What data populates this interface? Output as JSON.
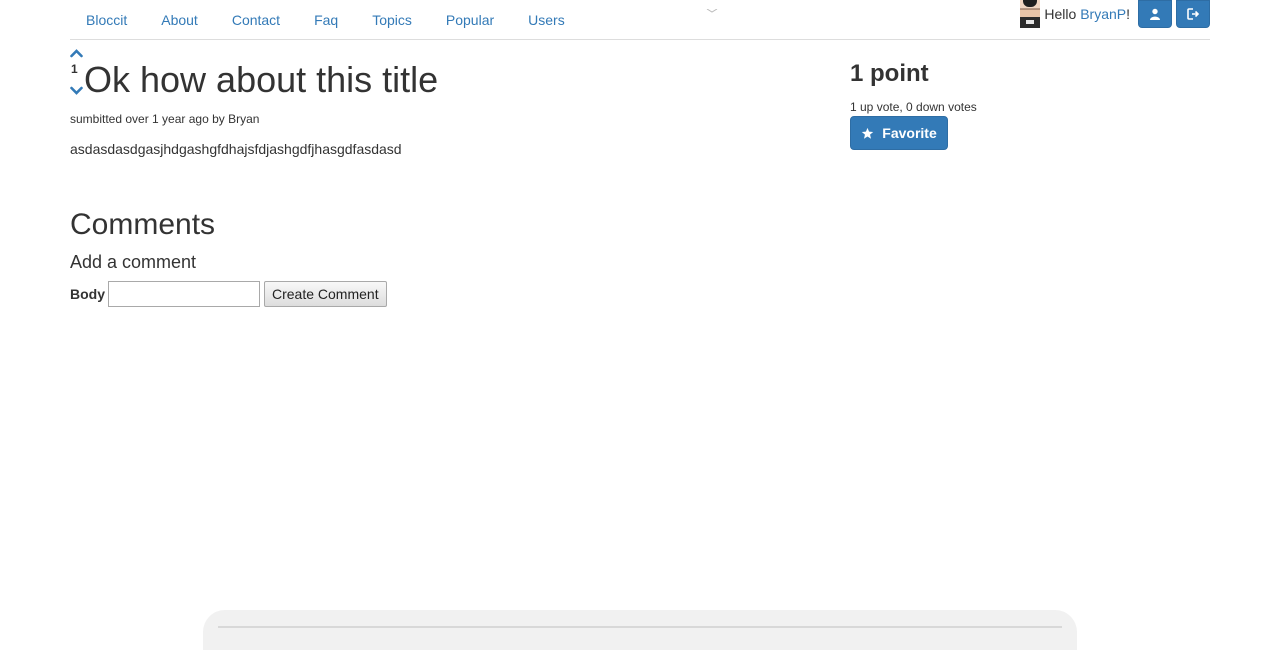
{
  "nav": {
    "links": [
      "Bloccit",
      "About",
      "Contact",
      "Faq",
      "Topics",
      "Popular",
      "Users"
    ],
    "greeting_prefix": "Hello ",
    "username": "BryanP",
    "greeting_suffix": "!",
    "profile_icon": "user-icon",
    "signout_icon": "sign-out-icon"
  },
  "post": {
    "vote_count": "1",
    "title": "Ok how about this title",
    "meta": "sumbitted over 1 year ago by Bryan",
    "body": "asdasdasdgasjhdgashgfdhajsfdjashgdfjhasgdfasdasd"
  },
  "comments": {
    "heading": "Comments",
    "add_heading": "Add a comment",
    "body_label": "Body",
    "body_value": "",
    "submit_label": "Create Comment"
  },
  "sidebar": {
    "points": "1 point",
    "votes": "1 up vote, 0 down votes",
    "favorite_label": "Favorite",
    "favorite_icon": "star-icon"
  },
  "colors": {
    "link": "#337ab7",
    "primary_button": "#337ab7",
    "text": "#333333"
  }
}
